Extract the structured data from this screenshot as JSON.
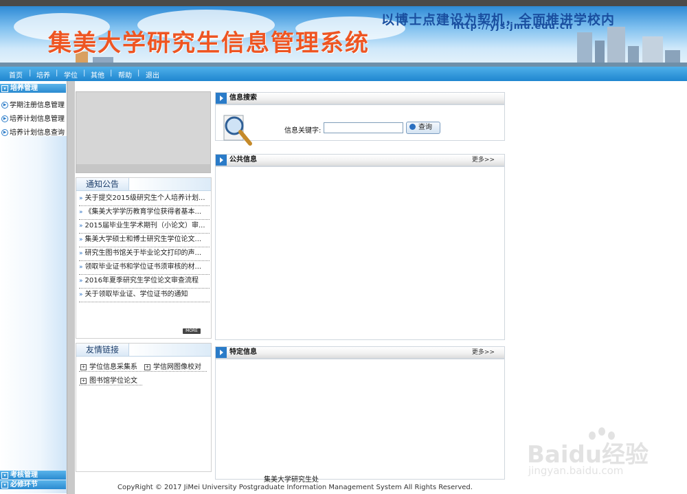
{
  "banner": {
    "title": "集美大学研究生信息管理系统",
    "slogan": "以博士点建设为契机，全面推进学校内",
    "url": "http://yjs.jmu.edu.cn"
  },
  "nav": {
    "items": [
      "首页",
      "培养",
      "学位",
      "其他",
      "帮助",
      "退出"
    ],
    "separator": "|"
  },
  "sidebar": {
    "top_section": "培养管理",
    "items": [
      "学期注册信息管理",
      "培养计划信息管理",
      "培养计划信息查询"
    ],
    "bottom_sections": [
      "考核管理",
      "必修环节"
    ]
  },
  "notice": {
    "title": "通知公告",
    "items": [
      "关于提交2015级研究生个人培养计划...",
      "《集美大学学历教育学位获得者基本...",
      "2015届毕业生学术期刊（小论文）审...",
      "集美大学硕士和博士研究生学位论文...",
      "研究生图书馆关于毕业论文打印的声...",
      "领取毕业证书和学位证书须审核的材...",
      "2016年夏季研究生学位论文审查流程",
      "关于领取毕业证、学位证书的通知"
    ],
    "more": "MORE"
  },
  "links": {
    "title": "友情链接",
    "items": [
      "学位信息采集系",
      "学信网图像校对",
      "图书馆学位论文"
    ]
  },
  "search": {
    "title": "信息搜索",
    "label": "信息关键字:",
    "value": "",
    "button": "查询"
  },
  "public_info": {
    "title": "公共信息",
    "more": "更多>>"
  },
  "specific_info": {
    "title": "特定信息",
    "more": "更多>>"
  },
  "footer": {
    "org": "集美大学研究生处",
    "copyright": "CopyRight © 2017 JiMei University Postgraduate Information Management System All Rights Reserved."
  },
  "watermark": {
    "brand": "Baidu经验",
    "url": "jingyan.baidu.com"
  }
}
